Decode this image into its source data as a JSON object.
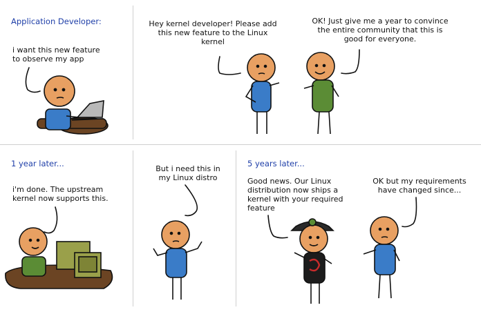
{
  "panels": {
    "p1": {
      "caption": "Application Developer:",
      "speech": "i want this new feature\nto observe my app"
    },
    "p2": {
      "speech_left": "Hey kernel developer! Please add\nthis new feature to the Linux\nkernel",
      "speech_right": "OK! Just give me a year to convince\nthe entire community that this is\ngood for everyone."
    },
    "p3": {
      "caption": "1 year later...",
      "speech": "i'm done. The upstream\nkernel now supports this."
    },
    "p4": {
      "speech": "But i need this in\nmy Linux distro"
    },
    "p5": {
      "caption": "5 years later...",
      "speech_left": "Good news. Our Linux\ndistribution now ships a\nkernel with your required\nfeature",
      "speech_right": "OK but my requirements\nhave changed since..."
    }
  },
  "colors": {
    "caption": "#1f3fa8",
    "skin": "#e8a062",
    "blue_shirt": "#3a7cc8",
    "green_shirt": "#5b8c35",
    "black_shirt": "#1c1c1c",
    "logo_red": "#c82b2b",
    "desk": "#6b4423",
    "computer": "#9aa04a"
  }
}
